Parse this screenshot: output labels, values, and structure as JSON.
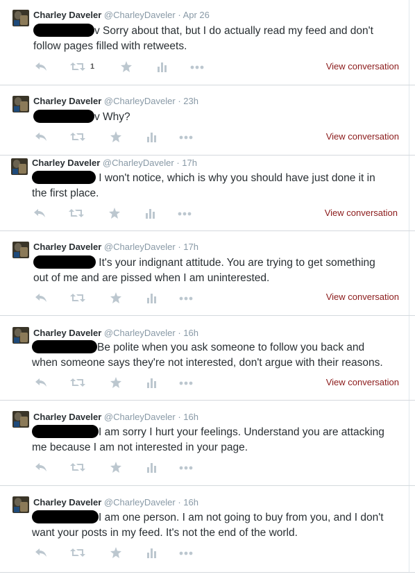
{
  "tweets": [
    {
      "name": "Charley Daveler",
      "handle": "@CharleyDaveler",
      "sep": "·",
      "time": "Apr 26",
      "text_line1": "v Sorry about that, but I do actually read my feed and don't",
      "text_line2": "follow pages filled with retweets.",
      "retweet_count": "1",
      "view": "View conversation"
    },
    {
      "name": "Charley Daveler",
      "handle": "@CharleyDaveler",
      "sep": "·",
      "time": "23h",
      "text_line1": "v Why?",
      "text_line2": "",
      "retweet_count": "",
      "view": "View conversation"
    },
    {
      "name": "Charley Daveler",
      "handle": "@CharleyDaveler",
      "sep": "·",
      "time": "17h",
      "text_line1": " I won't notice, which is why you should have just done it in",
      "text_line2": "the first place.",
      "retweet_count": "",
      "view": "View conversation"
    },
    {
      "name": "Charley Daveler",
      "handle": "@CharleyDaveler",
      "sep": "·",
      "time": "17h",
      "text_line1": " It's your indignant attitude. You are trying to get something",
      "text_line2": "out of me and are pissed when I am uninterested.",
      "retweet_count": "",
      "view": "View conversation"
    },
    {
      "name": "Charley Daveler",
      "handle": "@CharleyDaveler",
      "sep": "·",
      "time": "16h",
      "text_line1": "Be polite when you ask someone to follow you back and",
      "text_line2": "when someone says they're not interested, don't argue with their reasons.",
      "retweet_count": "",
      "view": "View conversation"
    },
    {
      "name": "Charley Daveler",
      "handle": "@CharleyDaveler",
      "sep": "·",
      "time": "16h",
      "text_line1": "I am sorry I hurt your feelings. Understand you are attacking",
      "text_line2": "me because I am not interested in your page.",
      "retweet_count": "",
      "view": ""
    },
    {
      "name": "Charley Daveler",
      "handle": "@CharleyDaveler",
      "sep": "·",
      "time": "16h",
      "text_line1": "I am one person. I am not going to buy from you, and I don't",
      "text_line2": "want your posts in my feed. It's not the end of the world.",
      "retweet_count": "",
      "view": ""
    }
  ],
  "icons": {
    "reply": "reply-icon",
    "retweet": "retweet-icon",
    "favorite": "star-icon",
    "analytics": "analytics-icon",
    "more": "more-icon"
  },
  "colors": {
    "link": "#8b1a1a",
    "muted": "#8899a6",
    "icon": "#bcc7cf",
    "text": "#292f33"
  }
}
